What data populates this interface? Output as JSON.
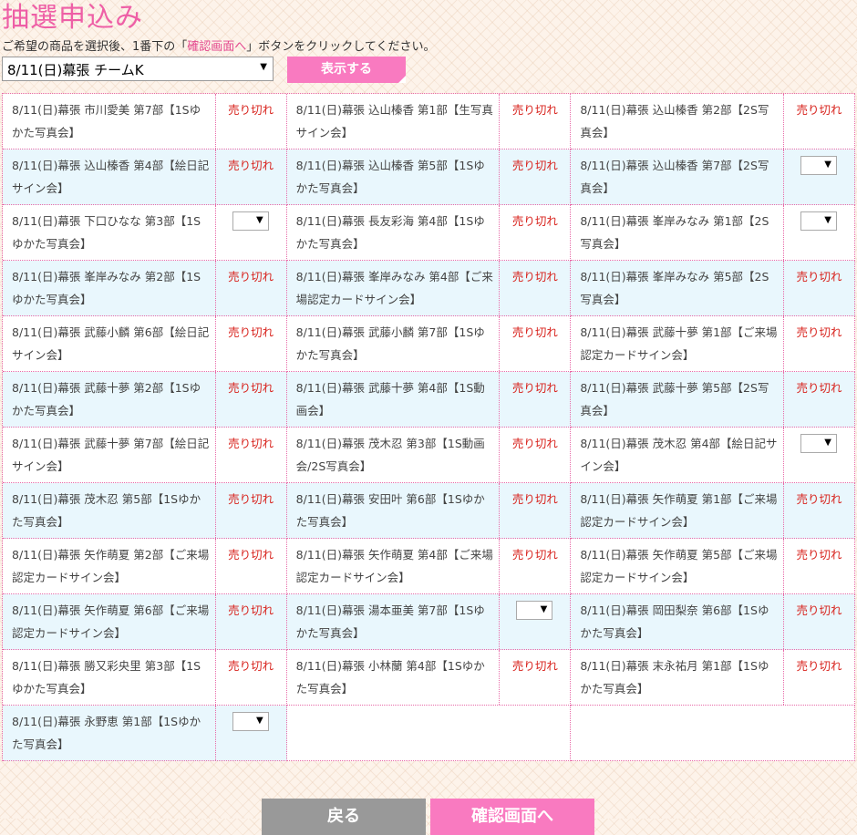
{
  "page": {
    "title": "抽選申込み",
    "instruction_before": "ご希望の商品を選択後、1番下の「",
    "instruction_link": "確認画面へ",
    "instruction_after": "」ボタンをクリックしてください。"
  },
  "event_select": {
    "value": "8/11(日)幕張 チームK"
  },
  "show_button": {
    "label": "表示する"
  },
  "sold_out_label": "売り切れ",
  "items": [
    {
      "name": "8/11(日)幕張 市川愛美 第7部【1Sゆかた写真会】",
      "status": "sold_out"
    },
    {
      "name": "8/11(日)幕張 込山榛香 第1部【生写真サイン会】",
      "status": "sold_out"
    },
    {
      "name": "8/11(日)幕張 込山榛香 第2部【2S写真会】",
      "status": "sold_out"
    },
    {
      "name": "8/11(日)幕張 込山榛香 第4部【絵日記サイン会】",
      "status": "sold_out"
    },
    {
      "name": "8/11(日)幕張 込山榛香 第5部【1Sゆかた写真会】",
      "status": "sold_out"
    },
    {
      "name": "8/11(日)幕張 込山榛香 第7部【2S写真会】",
      "status": "select"
    },
    {
      "name": "8/11(日)幕張 下口ひなな 第3部【1Sゆかた写真会】",
      "status": "select"
    },
    {
      "name": "8/11(日)幕張 長友彩海 第4部【1Sゆかた写真会】",
      "status": "sold_out"
    },
    {
      "name": "8/11(日)幕張 峯岸みなみ 第1部【2S写真会】",
      "status": "select"
    },
    {
      "name": "8/11(日)幕張 峯岸みなみ 第2部【1Sゆかた写真会】",
      "status": "sold_out"
    },
    {
      "name": "8/11(日)幕張 峯岸みなみ 第4部【ご来場認定カードサイン会】",
      "status": "sold_out"
    },
    {
      "name": "8/11(日)幕張 峯岸みなみ 第5部【2S写真会】",
      "status": "sold_out"
    },
    {
      "name": "8/11(日)幕張 武藤小麟 第6部【絵日記サイン会】",
      "status": "sold_out"
    },
    {
      "name": "8/11(日)幕張 武藤小麟 第7部【1Sゆかた写真会】",
      "status": "sold_out"
    },
    {
      "name": "8/11(日)幕張 武藤十夢 第1部【ご来場認定カードサイン会】",
      "status": "sold_out"
    },
    {
      "name": "8/11(日)幕張 武藤十夢 第2部【1Sゆかた写真会】",
      "status": "sold_out"
    },
    {
      "name": "8/11(日)幕張 武藤十夢 第4部【1S動画会】",
      "status": "sold_out"
    },
    {
      "name": "8/11(日)幕張 武藤十夢 第5部【2S写真会】",
      "status": "sold_out"
    },
    {
      "name": "8/11(日)幕張 武藤十夢 第7部【絵日記サイン会】",
      "status": "sold_out"
    },
    {
      "name": "8/11(日)幕張 茂木忍 第3部【1S動画会/2S写真会】",
      "status": "sold_out"
    },
    {
      "name": "8/11(日)幕張 茂木忍 第4部【絵日記サイン会】",
      "status": "select"
    },
    {
      "name": "8/11(日)幕張 茂木忍 第5部【1Sゆかた写真会】",
      "status": "sold_out"
    },
    {
      "name": "8/11(日)幕張 安田叶 第6部【1Sゆかた写真会】",
      "status": "sold_out"
    },
    {
      "name": "8/11(日)幕張 矢作萌夏 第1部【ご来場認定カードサイン会】",
      "status": "sold_out"
    },
    {
      "name": "8/11(日)幕張 矢作萌夏 第2部【ご来場認定カードサイン会】",
      "status": "sold_out"
    },
    {
      "name": "8/11(日)幕張 矢作萌夏 第4部【ご来場認定カードサイン会】",
      "status": "sold_out"
    },
    {
      "name": "8/11(日)幕張 矢作萌夏 第5部【ご来場認定カードサイン会】",
      "status": "sold_out"
    },
    {
      "name": "8/11(日)幕張 矢作萌夏 第6部【ご来場認定カードサイン会】",
      "status": "sold_out"
    },
    {
      "name": "8/11(日)幕張 湯本亜美 第7部【1Sゆかた写真会】",
      "status": "select"
    },
    {
      "name": "8/11(日)幕張 岡田梨奈 第6部【1Sゆかた写真会】",
      "status": "sold_out"
    },
    {
      "name": "8/11(日)幕張 勝又彩央里 第3部【1Sゆかた写真会】",
      "status": "sold_out"
    },
    {
      "name": "8/11(日)幕張 小林蘭 第4部【1Sゆかた写真会】",
      "status": "sold_out"
    },
    {
      "name": "8/11(日)幕張 末永祐月 第1部【1Sゆかた写真会】",
      "status": "sold_out"
    },
    {
      "name": "8/11(日)幕張 永野恵 第1部【1Sゆかた写真会】",
      "status": "select"
    }
  ],
  "footer": {
    "back_label": "戻る",
    "confirm_label": "確認画面へ"
  },
  "colors": {
    "accent_pink": "#f97ac0",
    "title_pink": "#ee5fa6",
    "sold_out_red": "#d8231d",
    "row_shade": "#e9f7fd"
  }
}
